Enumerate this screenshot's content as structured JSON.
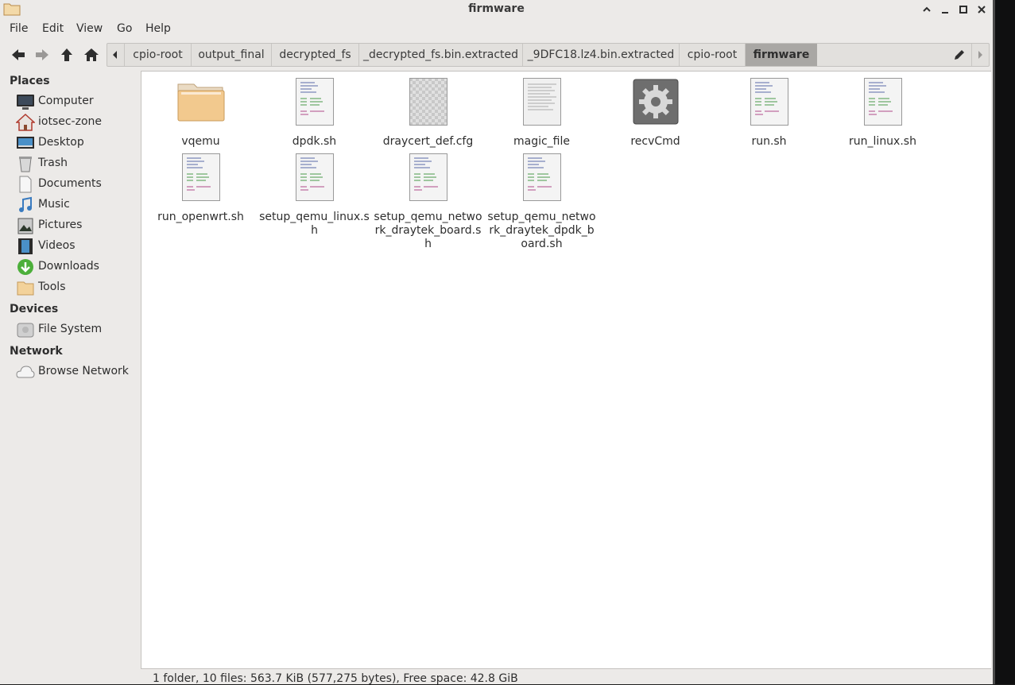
{
  "window": {
    "title": "firmware"
  },
  "menu": [
    "File",
    "Edit",
    "View",
    "Go",
    "Help"
  ],
  "pathbar": {
    "crumbs": [
      "cpio-root",
      "output_final",
      "decrypted_fs",
      "_decrypted_fs.bin.extracted",
      "_9DFC18.lz4.bin.extracted",
      "cpio-root",
      "firmware"
    ]
  },
  "sidebar": {
    "places_header": "Places",
    "places": [
      {
        "label": "Computer",
        "icon": "computer-icon"
      },
      {
        "label": "iotsec-zone",
        "icon": "home-icon"
      },
      {
        "label": "Desktop",
        "icon": "desktop-icon"
      },
      {
        "label": "Trash",
        "icon": "trash-icon"
      },
      {
        "label": "Documents",
        "icon": "documents-icon"
      },
      {
        "label": "Music",
        "icon": "music-icon"
      },
      {
        "label": "Pictures",
        "icon": "pictures-icon"
      },
      {
        "label": "Videos",
        "icon": "videos-icon"
      },
      {
        "label": "Downloads",
        "icon": "downloads-icon"
      },
      {
        "label": "Tools",
        "icon": "folder-icon"
      }
    ],
    "devices_header": "Devices",
    "devices": [
      {
        "label": "File System",
        "icon": "drive-icon"
      }
    ],
    "network_header": "Network",
    "network": [
      {
        "label": "Browse Network",
        "icon": "network-icon"
      }
    ]
  },
  "files": [
    {
      "name": "vqemu",
      "type": "folder"
    },
    {
      "name": "dpdk.sh",
      "type": "script"
    },
    {
      "name": "draycert_def.cfg",
      "type": "config"
    },
    {
      "name": "magic_file",
      "type": "text"
    },
    {
      "name": "recvCmd",
      "type": "executable"
    },
    {
      "name": "run.sh",
      "type": "script"
    },
    {
      "name": "run_linux.sh",
      "type": "script"
    },
    {
      "name": "run_openwrt.sh",
      "type": "script"
    },
    {
      "name": "setup_qemu_linux.sh",
      "type": "script",
      "lines": [
        "setup_qemu_linux.s",
        "h"
      ]
    },
    {
      "name": "setup_qemu_network_draytek_board.sh",
      "type": "script",
      "lines": [
        "setup_qemu_netwo",
        "rk_draytek_board.s",
        "h"
      ]
    },
    {
      "name": "setup_qemu_network_draytek_dpdk_board.sh",
      "type": "script",
      "lines": [
        "setup_qemu_netwo",
        "rk_draytek_dpdk_b",
        "oard.sh"
      ]
    }
  ],
  "status": {
    "text": "1 folder, 10 files: 563.7 KiB (577,275 bytes), Free space: 42.8 GiB"
  },
  "colors": {
    "window_bg": "#eceae8",
    "active_crumb": "#a9a7a4",
    "folder": "#f0c98a"
  }
}
